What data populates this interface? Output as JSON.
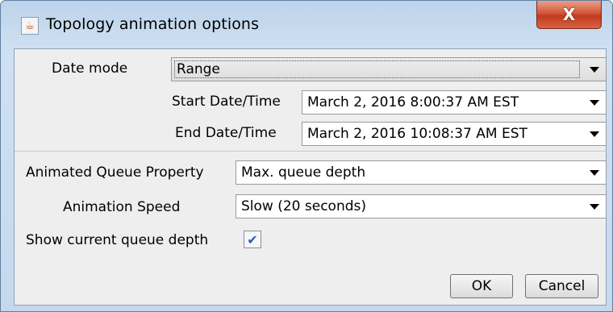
{
  "window": {
    "title": "Topology animation options",
    "close_glyph": "X"
  },
  "form": {
    "date_mode": {
      "label": "Date mode",
      "value": "Range"
    },
    "start": {
      "label": "Start Date/Time",
      "value": "March 2, 2016 8:00:37 AM EST"
    },
    "end": {
      "label": "End Date/Time",
      "value": "March 2, 2016 10:08:37 AM EST"
    },
    "queue_property": {
      "label": "Animated Queue Property",
      "value": "Max. queue depth"
    },
    "speed": {
      "label": "Animation Speed",
      "value": "Slow (20 seconds)"
    },
    "show_depth": {
      "label": "Show current queue depth",
      "checked": true
    }
  },
  "buttons": {
    "ok": "OK",
    "cancel": "Cancel"
  },
  "icons": {
    "app": "java-coffee-cup-icon",
    "close": "close-x-icon",
    "dropdown": "chevron-down-icon",
    "check": "checkmark-icon"
  },
  "colors": {
    "titlebar": "#c5d9ee",
    "close": "#c7452a",
    "panel": "#eeeeee",
    "check": "#2b5fb0"
  }
}
